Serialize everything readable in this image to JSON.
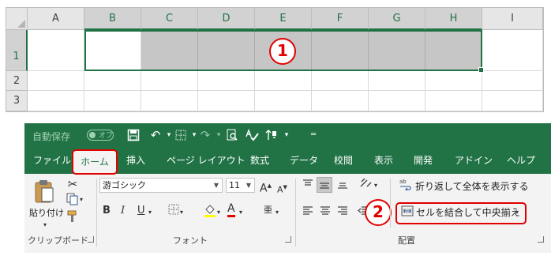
{
  "sheet": {
    "columns": [
      "A",
      "B",
      "C",
      "D",
      "E",
      "F",
      "G",
      "H",
      "I"
    ],
    "rows": [
      "1",
      "2",
      "3"
    ]
  },
  "callouts": {
    "step1": "1",
    "step2": "2"
  },
  "colors": {
    "accent": "#217346",
    "highlight_red": "#e00000",
    "selected_fill": "#c6c6c6"
  },
  "ribbon": {
    "qat": {
      "autosave_label": "自動保存",
      "autosave_state": "オフ",
      "icons": [
        "save-icon",
        "undo-icon",
        "borders-icon",
        "redo-icon",
        "print-preview-icon",
        "spellcheck-icon",
        "sort-icon",
        "customize-icon"
      ]
    },
    "tabs": [
      {
        "label": "ファイル"
      },
      {
        "label": "ホーム"
      },
      {
        "label": "挿入"
      },
      {
        "label": "ページ レイアウト"
      },
      {
        "label": "数式"
      },
      {
        "label": "データ"
      },
      {
        "label": "校閲"
      },
      {
        "label": "表示"
      },
      {
        "label": "開発"
      },
      {
        "label": "アドイン"
      },
      {
        "label": "ヘルプ"
      }
    ],
    "active_tab": "ホーム",
    "clipboard": {
      "paste_label": "貼り付け",
      "group_label": "クリップボード"
    },
    "font": {
      "font_name": "游ゴシック",
      "font_size": "11",
      "grow_label": "A",
      "shrink_label": "A",
      "bold": "B",
      "italic": "I",
      "underline": "U",
      "font_color_letter": "A",
      "phonetic_label": "亜",
      "group_label": "フォント"
    },
    "alignment": {
      "wrap_text_label": "折り返して全体を表示する",
      "merge_center_label": "セルを結合して中央揃え",
      "group_label": "配置"
    }
  }
}
